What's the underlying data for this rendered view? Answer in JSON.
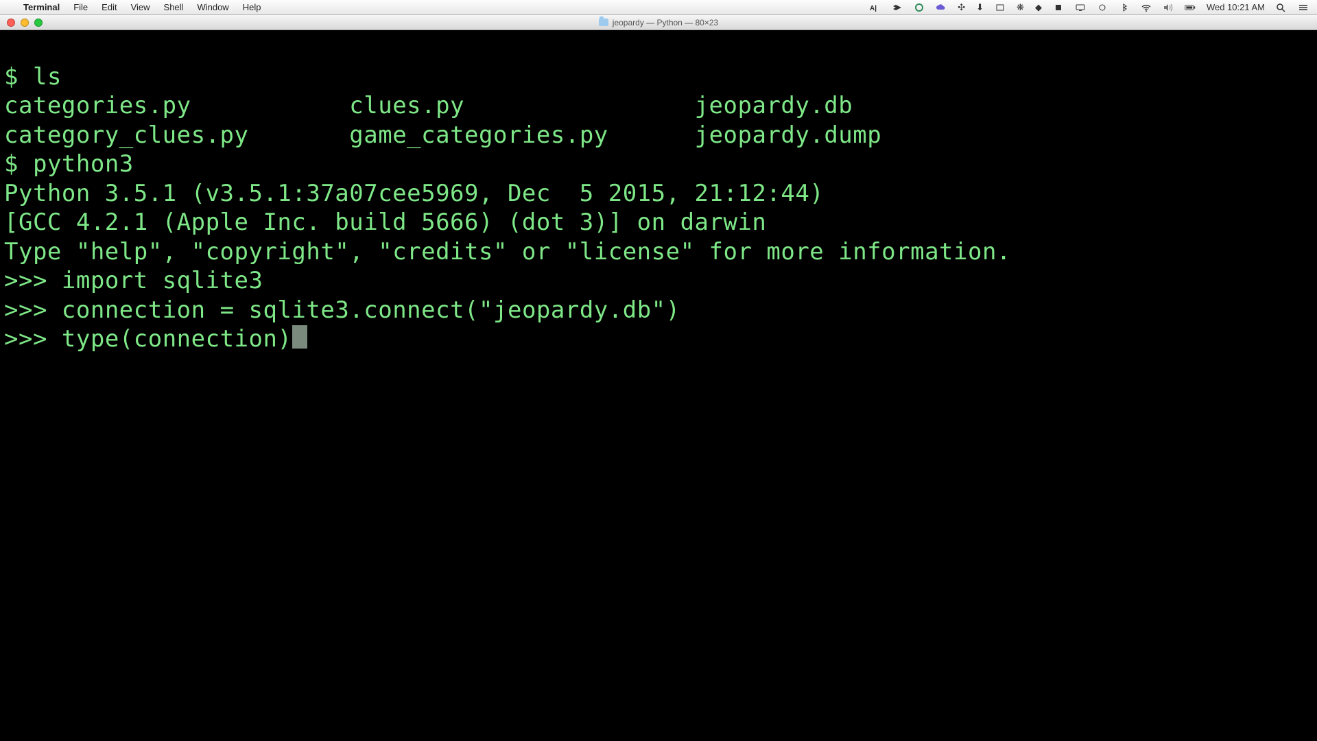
{
  "menubar": {
    "apple_glyph": "",
    "app_name": "Terminal",
    "items": [
      "File",
      "Edit",
      "View",
      "Shell",
      "Window",
      "Help"
    ],
    "clock": "Wed 10:21 AM"
  },
  "window": {
    "title": "jeopardy — Python — 80×23"
  },
  "terminal": {
    "shell_prompt": "$",
    "repl_prompt": ">>>",
    "cmd_ls": "ls",
    "ls_output": {
      "col1": [
        "categories.py",
        "category_clues.py"
      ],
      "col2": [
        "clues.py",
        "game_categories.py"
      ],
      "col3": [
        "jeopardy.db",
        "jeopardy.dump"
      ]
    },
    "cmd_python": "python3",
    "python_banner": [
      "Python 3.5.1 (v3.5.1:37a07cee5969, Dec  5 2015, 21:12:44)",
      "[GCC 4.2.1 (Apple Inc. build 5666) (dot 3)] on darwin",
      "Type \"help\", \"copyright\", \"credits\" or \"license\" for more information."
    ],
    "repl_lines": [
      "import sqlite3",
      "connection = sqlite3.connect(\"jeopardy.db\")",
      "type(connection)"
    ]
  }
}
